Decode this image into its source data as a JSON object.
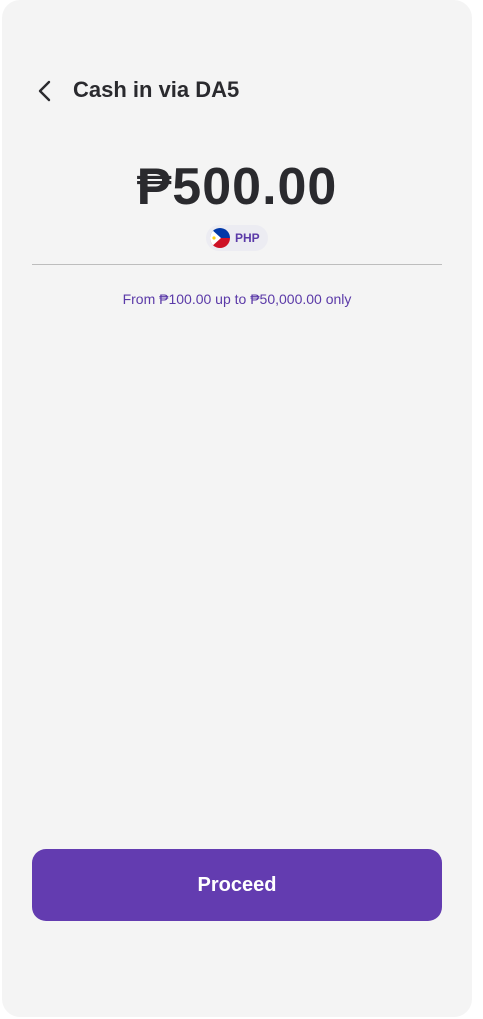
{
  "header": {
    "title": "Cash in via DA5",
    "back_icon": "chevron-left-icon"
  },
  "amount": {
    "value": "₱500.00",
    "currency_code": "PHP",
    "currency_flag_icon": "philippines-flag-icon"
  },
  "limit_note": "From ₱100.00 up to ₱50,000.00 only",
  "actions": {
    "proceed_label": "Proceed"
  },
  "colors": {
    "background": "#f4f4f4",
    "accent": "#633cb0",
    "accent_text": "#5b3aa8",
    "text_primary": "#2a2a2e",
    "divider": "#bdbdbd"
  }
}
